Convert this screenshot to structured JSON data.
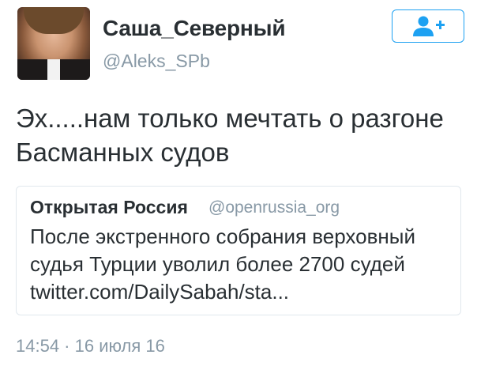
{
  "author": {
    "name": "Саша_Северный",
    "handle": "@Aleks_SPb",
    "avatar_icon": "profile-photo"
  },
  "follow_button": {
    "icon": "add-user-icon",
    "accent": "#1da1f2"
  },
  "tweet": {
    "text_line1": "Эх.....нам только мечтать о разгоне",
    "text_line2": "Басманных судов"
  },
  "quoted_tweet": {
    "name": "Открытая Россия",
    "handle": "@openrussia_org",
    "text_line1": "После экстренного собрания верховный",
    "text_line2": "судья Турции уволил более 2700 судей",
    "text_line3": "twitter.com/DailySabah/sta..."
  },
  "timestamp": "14:54 · 16 июля 16",
  "colors": {
    "text": "#292f33",
    "muted": "#8899a6",
    "border": "#e1e8ed",
    "accent": "#1da1f2"
  }
}
